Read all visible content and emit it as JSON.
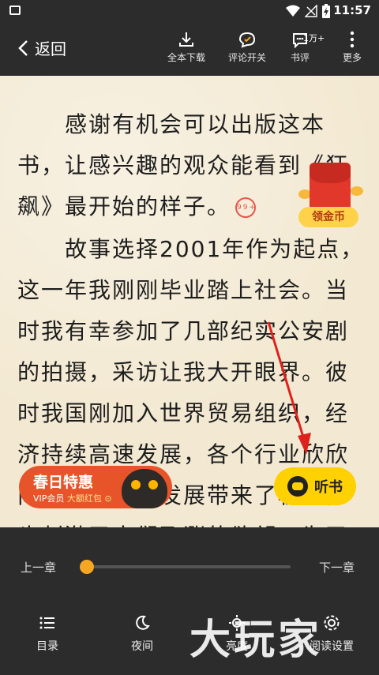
{
  "status_bar": {
    "time": "11:57"
  },
  "top_bar": {
    "back_label": "返回",
    "tools": [
      {
        "label": "全本下载",
        "icon": "download-icon"
      },
      {
        "label": "评论开关",
        "icon": "comment-toggle-icon"
      },
      {
        "label": "书评",
        "icon": "book-review-icon",
        "badge": "1万+"
      },
      {
        "label": "更多",
        "icon": "more-vertical-icon"
      }
    ]
  },
  "reader": {
    "top_fragment": "“",
    "paragraphs": [
      {
        "lines": [
          "　　感谢有机会可以出版这本",
          "书，让感兴趣的观众能看到《狂",
          "飙》最开始的样子。"
        ],
        "comment_badge": "99+"
      },
      {
        "lines": [
          "　　故事选择2001年作为起点，",
          "这一年我刚刚毕业踏上社会。当",
          "时我有幸参加了几部纪实公安剧",
          "的拍摄，采访让我大开眼界。彼",
          "时我国刚加入世界贸易组织，经",
          "济持续高速发展，各个行业欣欣",
          "向荣，城市化发展带来了机遇，",
          "也刺激了人们飞涨的欲望。为了"
        ]
      }
    ]
  },
  "red_packet": {
    "label": "领金币"
  },
  "promo": {
    "title": "春日特惠",
    "subtitle_a": "VIP会员",
    "subtitle_b": "大额红包 ⊙"
  },
  "listen_button": {
    "label": "听书"
  },
  "bottom_bar": {
    "prev_chapter": "上一章",
    "next_chapter": "下一章",
    "progress": 0.0,
    "nav": [
      {
        "label": "目录",
        "icon": "toc-icon"
      },
      {
        "label": "夜间",
        "icon": "moon-icon"
      },
      {
        "label": "亮度",
        "icon": "brightness-icon"
      },
      {
        "label": "阅读设置",
        "icon": "settings-icon"
      }
    ]
  },
  "watermark": "大玩家",
  "colors": {
    "bar": "#2c2c2c",
    "paper": "#f3e9d2",
    "accent": "#f5a623",
    "listen": "#ffd100",
    "promo": "#e8542a"
  }
}
